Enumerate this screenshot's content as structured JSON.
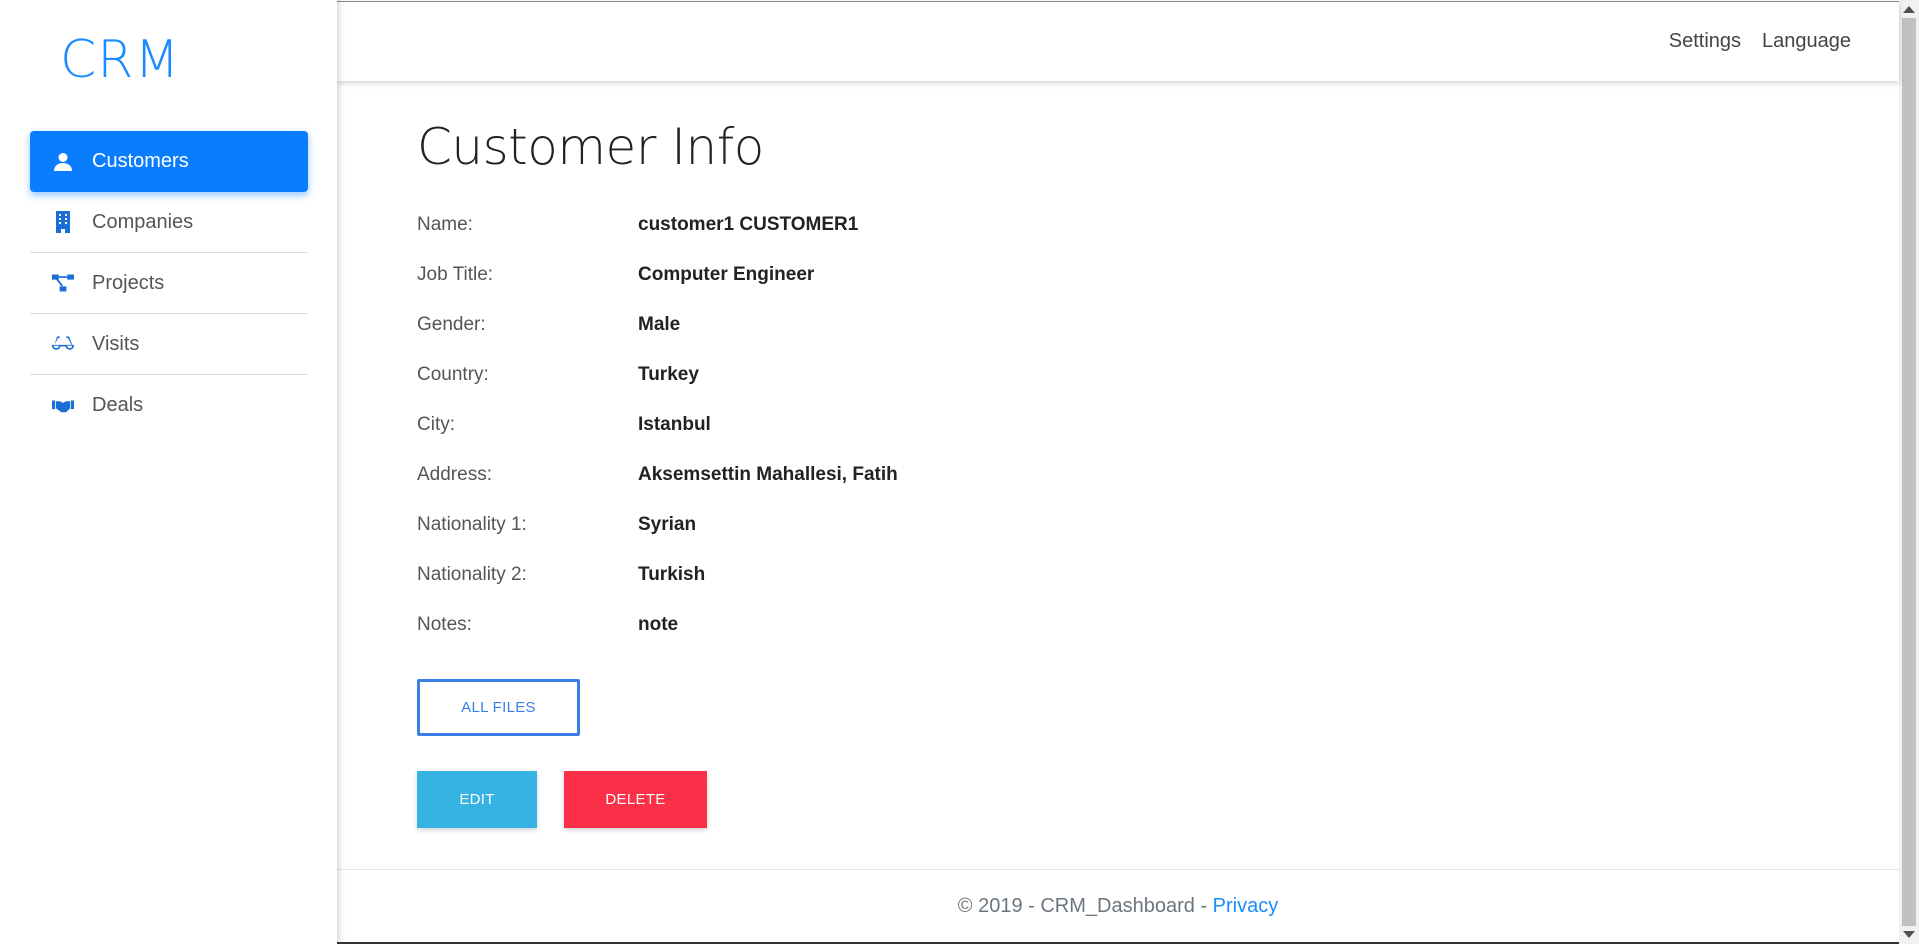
{
  "brand": "CRM",
  "sidebar": {
    "items": [
      {
        "label": "Customers",
        "icon": "user-icon",
        "active": true
      },
      {
        "label": "Companies",
        "icon": "building-icon",
        "active": false
      },
      {
        "label": "Projects",
        "icon": "project-diagram-icon",
        "active": false
      },
      {
        "label": "Visits",
        "icon": "glasses-icon",
        "active": false
      },
      {
        "label": "Deals",
        "icon": "handshake-icon",
        "active": false
      }
    ]
  },
  "topnav": {
    "settings": "Settings",
    "language": "Language"
  },
  "page": {
    "title": "Customer Info"
  },
  "info": {
    "rows": [
      {
        "label": "Name:",
        "value": "customer1 CUSTOMER1"
      },
      {
        "label": "Job Title:",
        "value": "Computer Engineer"
      },
      {
        "label": "Gender:",
        "value": "Male"
      },
      {
        "label": "Country:",
        "value": "Turkey"
      },
      {
        "label": "City:",
        "value": "Istanbul"
      },
      {
        "label": "Address:",
        "value": "Aksemsettin Mahallesi, Fatih"
      },
      {
        "label": "Nationality 1:",
        "value": "Syrian"
      },
      {
        "label": "Nationality 2:",
        "value": "Turkish"
      },
      {
        "label": "Notes:",
        "value": "note"
      }
    ]
  },
  "buttons": {
    "all_files": "ALL FILES",
    "edit": "EDIT",
    "delete": "DELETE"
  },
  "footer": {
    "text": "© 2019 - CRM_Dashboard - ",
    "privacy": "Privacy"
  },
  "colors": {
    "accent": "#0a7dff",
    "edit": "#36b3e2",
    "delete": "#fb2f48",
    "outline": "#3a7ee6"
  }
}
